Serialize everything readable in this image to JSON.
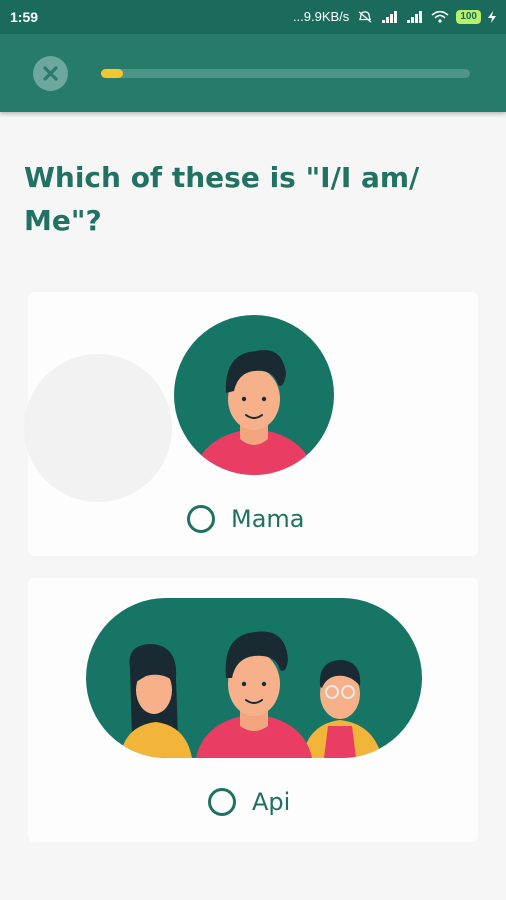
{
  "status_bar": {
    "time": "1:59",
    "network_speed": "...9.9KB/s",
    "battery": "100",
    "icons": [
      "mute-icon",
      "signal-icon",
      "signal-icon",
      "wifi-icon",
      "battery-icon",
      "charging-icon"
    ]
  },
  "header": {
    "close_icon": "close-icon",
    "progress": 0.06,
    "colors": {
      "bar": "#277b69",
      "progress_fill": "#f2c62f",
      "track": "#4f9585"
    }
  },
  "question": {
    "text": "Which of these is \"I/I am/ Me\"?"
  },
  "options": [
    {
      "label": "Mama",
      "image": "single-person-illustration",
      "selected": false
    },
    {
      "label": "Api",
      "image": "group-of-three-people-illustration",
      "selected": false
    }
  ],
  "colors": {
    "accent": "#1f7262",
    "illustration_bg": "#167564",
    "shirt": "#e93d63"
  }
}
